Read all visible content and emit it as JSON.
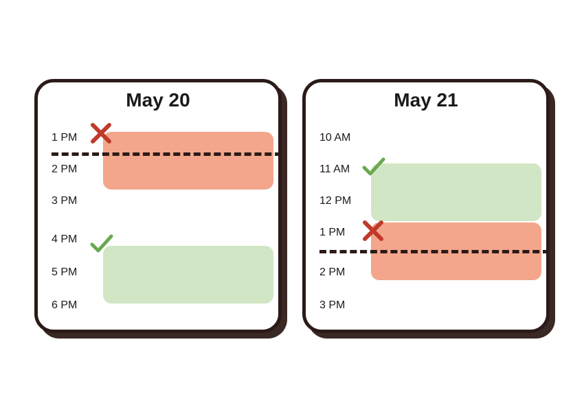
{
  "cards": [
    {
      "title": "May 20",
      "time_labels": [
        "1 PM",
        "2 PM",
        "3 PM",
        "4 PM",
        "5 PM",
        "6 PM"
      ]
    },
    {
      "title": "May 21",
      "time_labels": [
        "10 AM",
        "11 AM",
        "12 PM",
        "1 PM",
        "2 PM",
        "3 PM"
      ]
    }
  ],
  "colors": {
    "red_block": "#f3a68b",
    "green_block": "#d1e6c4",
    "border": "#2b1a17",
    "x_stroke": "#c0392b",
    "check_stroke": "#6aa84f"
  }
}
